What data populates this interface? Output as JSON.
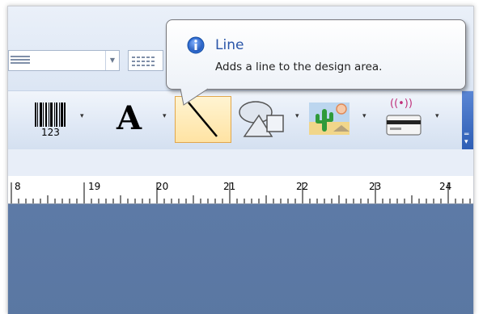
{
  "tooltip": {
    "title": "Line",
    "description": "Adds a line to the design area.",
    "icon": "info-icon"
  },
  "toolbar": {
    "buttons": [
      {
        "name": "barcode",
        "icon": "barcode-icon",
        "label": "123",
        "has_dropdown": true
      },
      {
        "name": "text",
        "icon": "text-icon",
        "label": "A",
        "has_dropdown": true
      },
      {
        "name": "line",
        "icon": "line-icon",
        "selected": true,
        "has_dropdown": false
      },
      {
        "name": "shape",
        "icon": "shapes-icon",
        "has_dropdown": true
      },
      {
        "name": "picture",
        "icon": "picture-icon",
        "has_dropdown": true
      },
      {
        "name": "rfid",
        "icon": "rfid-icon",
        "label": "((•))",
        "has_dropdown": true
      }
    ],
    "caret": "▾",
    "overflow": "overflow-chevron-icon"
  },
  "ruler": {
    "labels": [
      "8",
      "19",
      "20",
      "21",
      "22",
      "23",
      "24"
    ]
  },
  "colors": {
    "design_area": "#5d7aa6",
    "selected_button": "#ffe3a3",
    "toolbar": "#dfe8f5",
    "tooltip_title": "#2a55a8"
  }
}
